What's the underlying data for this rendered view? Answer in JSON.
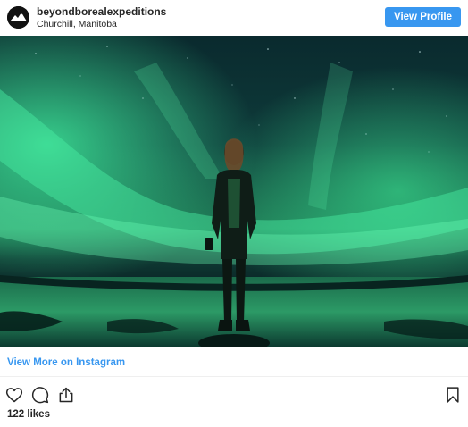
{
  "header": {
    "username": "beyondborealexpeditions",
    "location": "Churchill, Manitoba",
    "view_profile_label": "View Profile"
  },
  "post": {
    "view_more_label": "View More on Instagram",
    "likes_text": "122 likes"
  },
  "icons": {
    "avatar": "mountain-logo-icon",
    "like": "heart-icon",
    "comment": "comment-bubble-icon",
    "share": "share-upload-icon",
    "save": "bookmark-icon"
  },
  "colors": {
    "accent": "#3897f0",
    "text": "#262626"
  }
}
